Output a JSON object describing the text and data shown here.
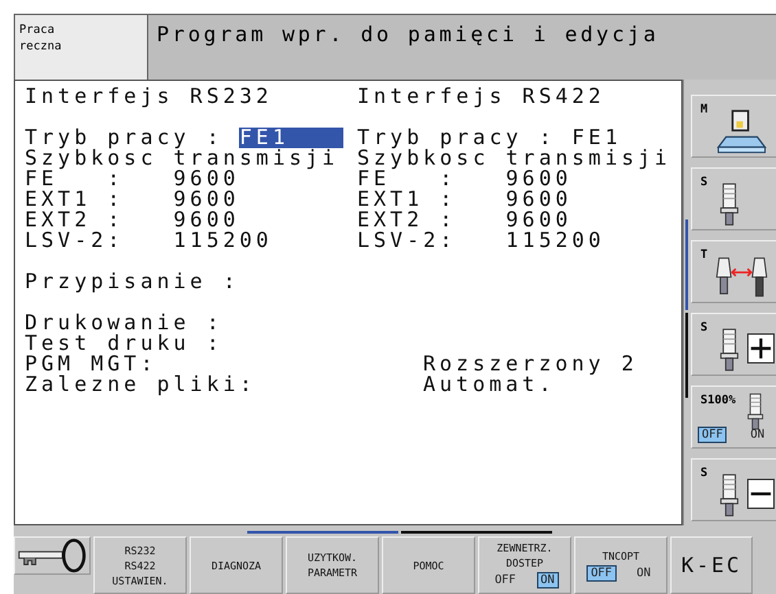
{
  "mode": {
    "label": "Praca reczna"
  },
  "title": "Program wpr. do pamięci i edycja",
  "panel": {
    "rows": [
      {
        "kind": "pair",
        "left": "Interfejs RS232",
        "right": "Interfejs RS422"
      },
      {
        "kind": "blank"
      },
      {
        "kind": "field",
        "left": "Tryb pracy : ",
        "value": "FE1",
        "right": "Tryb pracy : FE1"
      },
      {
        "kind": "pair",
        "left": "Szybkosc transmisji",
        "right": "Szybkosc transmisji"
      },
      {
        "kind": "pair",
        "left": "FE   :   9600",
        "right": "FE   :   9600"
      },
      {
        "kind": "pair",
        "left": "EXT1 :   9600",
        "right": "EXT1 :   9600"
      },
      {
        "kind": "pair",
        "left": "EXT2 :   9600",
        "right": "EXT2 :   9600"
      },
      {
        "kind": "pair",
        "left": "LSV-2:   115200",
        "right": "LSV-2:   115200"
      },
      {
        "kind": "blank"
      },
      {
        "kind": "pair",
        "left": "Przypisanie :"
      },
      {
        "kind": "blank"
      },
      {
        "kind": "pair",
        "left": "Drukowanie :"
      },
      {
        "kind": "pair",
        "left": "Test druku :"
      },
      {
        "kind": "setting",
        "left": "PGM MGT:",
        "right": "Rozszerzony 2"
      },
      {
        "kind": "setting",
        "left": "Zalezne pliki:",
        "right": "Automat."
      }
    ]
  },
  "side_softkeys": [
    {
      "kind": "machine",
      "label": "M"
    },
    {
      "kind": "spindle",
      "label": "S"
    },
    {
      "kind": "tool-change",
      "label": "T"
    },
    {
      "kind": "spindle-plus",
      "label": "S"
    },
    {
      "kind": "spindle-override",
      "label": "S100%",
      "options": [
        {
          "label": "OFF",
          "selected": true
        },
        {
          "label": "ON",
          "selected": false
        }
      ]
    },
    {
      "kind": "spindle-minus",
      "label": "S"
    }
  ],
  "softkeys": [
    {
      "kind": "key"
    },
    {
      "kind": "text",
      "lines": [
        "RS232",
        "RS422",
        "USTAWIEN."
      ]
    },
    {
      "kind": "text",
      "lines": [
        "DIAGNOZA"
      ]
    },
    {
      "kind": "text",
      "lines": [
        "UZYTKOW.",
        "PARAMETR"
      ]
    },
    {
      "kind": "text",
      "lines": [
        "POMOC"
      ]
    },
    {
      "kind": "toggle",
      "lines": [
        "ZEWNETRZ.",
        "DOSTEP"
      ],
      "options": [
        {
          "label": "OFF",
          "selected": false
        },
        {
          "label": "ON",
          "selected": true
        }
      ]
    },
    {
      "kind": "toggle",
      "lines": [
        "TNCOPT"
      ],
      "options": [
        {
          "label": "OFF",
          "selected": true
        },
        {
          "label": "ON",
          "selected": false
        }
      ]
    },
    {
      "kind": "large",
      "lines": [
        "K-EC"
      ]
    }
  ]
}
